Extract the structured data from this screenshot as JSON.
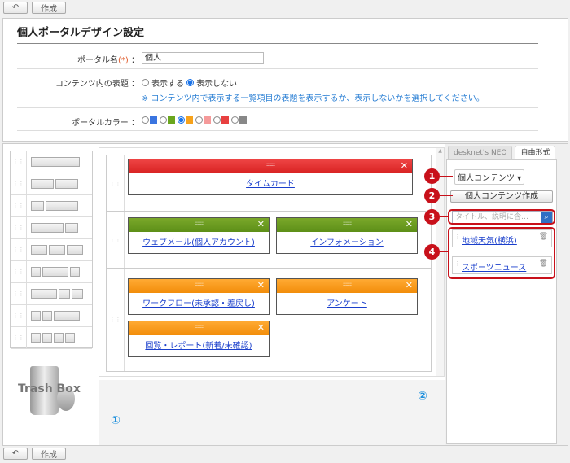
{
  "toolbar": {
    "back_icon": "↶",
    "create_label": "作成"
  },
  "page": {
    "title": "個人ポータルデザイン設定"
  },
  "form": {
    "portal_name": {
      "label": "ポータル名",
      "required_mark": "(*)",
      "colon": "：",
      "value": "個人"
    },
    "header_display": {
      "label": "コンテンツ内の表題",
      "colon": "：",
      "options": [
        "表示する",
        "表示しない"
      ],
      "selected": "表示しない",
      "note": "※ コンテンツ内で表示する一覧項目の表題を表示するか、表示しないかを選択してください。"
    },
    "portal_color": {
      "label": "ポータルカラー",
      "colon": "：",
      "colors": [
        "#3a75e0",
        "#6aa61e",
        "#f7a21b",
        "#f59a9a",
        "#e84040",
        "#888888"
      ],
      "selected_index": 2
    }
  },
  "layout": {
    "portlets": [
      {
        "title": "タイムカード",
        "color": "red"
      },
      {
        "title": "ウェブメール(個人アカウント)",
        "color": "green"
      },
      {
        "title": "インフォメーション",
        "color": "green"
      },
      {
        "title": "ワークフロー(未承認・差戻し)",
        "color": "orange"
      },
      {
        "title": "アンケート",
        "color": "orange"
      },
      {
        "title": "回覧・レポート(新着/未確認)",
        "color": "orange"
      }
    ],
    "close_icon": "✕",
    "drag_dots": "::::::::::"
  },
  "trash": {
    "label": "Trash Box"
  },
  "sidebar": {
    "tabs": [
      "desknet's NEO",
      "自由形式"
    ],
    "active_tab": "自由形式",
    "select_value": "個人コンテンツ",
    "create_button": "個人コンテンツ作成",
    "search_placeholder": "タイトル、説明に含…",
    "items": [
      "地域天気(横浜)",
      "スポーツニュース"
    ],
    "delete_icon": "🗑"
  },
  "callouts": [
    "1",
    "2",
    "3",
    "4"
  ],
  "guide": {
    "step1": "①",
    "step2": "②",
    "tab": "desknet's NEO",
    "masked": "●●●●●●●●●●"
  }
}
